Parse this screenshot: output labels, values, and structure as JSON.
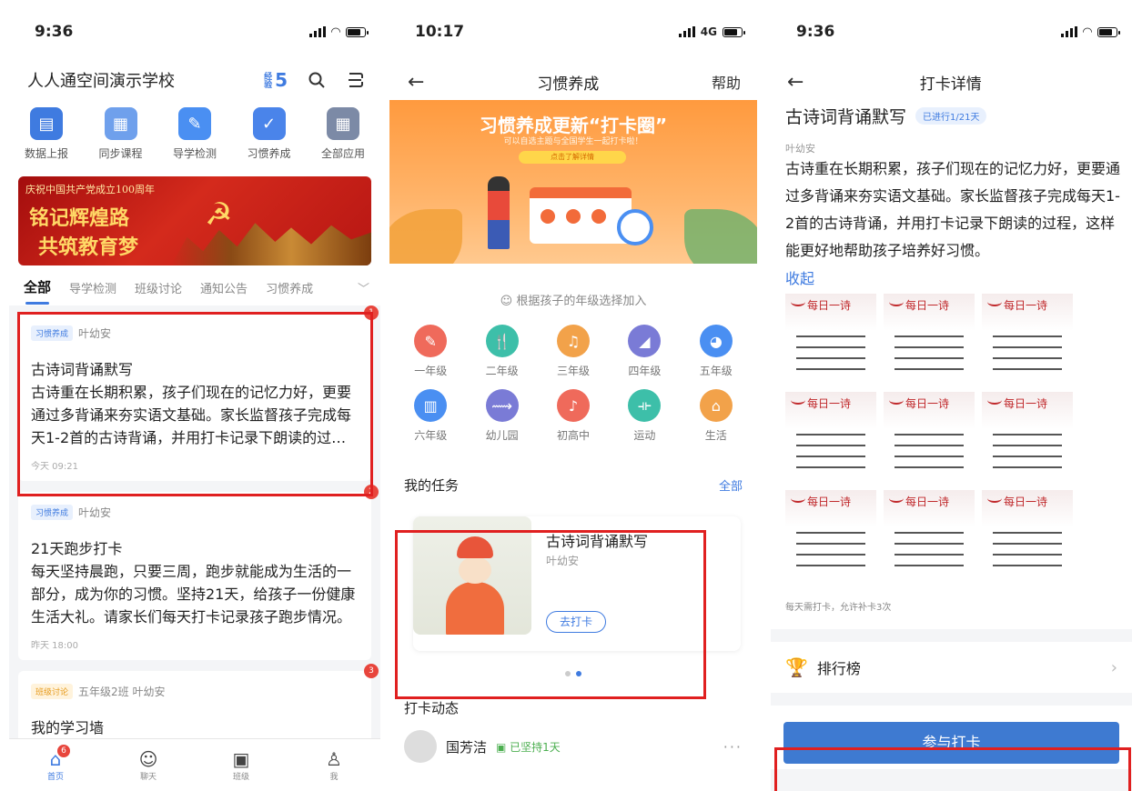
{
  "screen1": {
    "time": "9:36",
    "school": "人人通空间演示学校",
    "badge_label": "经验",
    "badge_count": "5",
    "apps": [
      {
        "label": "数据上报",
        "color": "#3f7be0"
      },
      {
        "label": "同步课程",
        "color": "#6fa0ec"
      },
      {
        "label": "导学检测",
        "color": "#4a8ff2"
      },
      {
        "label": "习惯养成",
        "color": "#4a84ea"
      },
      {
        "label": "全部应用",
        "color": "#7c8aa6"
      }
    ],
    "banner": {
      "subtitle": "庆祝中国共产党成立100周年",
      "line1": "铭记辉煌路",
      "line2": "共筑教育梦"
    },
    "tabs": [
      "全部",
      "导学检测",
      "班级讨论",
      "通知公告",
      "习惯养成"
    ],
    "cards": [
      {
        "tag": "习惯养成",
        "author": "叶幼安",
        "title": "古诗词背诵默写",
        "desc": "古诗重在长期积累，孩子们现在的记忆力好，更要通过多背诵来夯实语文基础。家长监督孩子完成每天1-2首的古诗背诵，并用打卡记录下朗读的过程。",
        "time": "今天 09:21",
        "dot": "1"
      },
      {
        "tag": "习惯养成",
        "author": "叶幼安",
        "title": "21天跑步打卡",
        "desc": "每天坚持晨跑，只要三周，跑步就能成为生活的一部分，成为你的习惯。坚持21天，给孩子一份健康生活大礼。请家长们每天打卡记录孩子跑步情况。",
        "time": "昨天 18:00",
        "dot": "2"
      },
      {
        "tag": "班级讨论",
        "author": "五年级2班 叶幼安",
        "title": "我的学习墙",
        "desc": "",
        "time": "",
        "dot": "3"
      }
    ],
    "tabbar": [
      {
        "label": "首页",
        "badge": "6"
      },
      {
        "label": "聊天"
      },
      {
        "label": "班级"
      },
      {
        "label": "我"
      }
    ]
  },
  "screen2": {
    "time": "10:17",
    "network": "4G",
    "title": "习惯养成",
    "help": "帮助",
    "hero": {
      "title": "习惯养成更新“打卡圈”",
      "subtitle": "可以自选主题与全国学生一起打卡啦！",
      "button": "点击了解详情"
    },
    "pick_hint": "根据孩子的年级选择加入",
    "grades": [
      {
        "label": "一年级",
        "color": "#ef6a5b",
        "icon": "✎"
      },
      {
        "label": "二年级",
        "color": "#3dbfa9",
        "icon": "🍴"
      },
      {
        "label": "三年级",
        "color": "#f2a24a",
        "icon": "♫"
      },
      {
        "label": "四年级",
        "color": "#7a7bd6",
        "icon": "◢"
      },
      {
        "label": "五年级",
        "color": "#4a8ff2",
        "icon": "◕"
      },
      {
        "label": "六年级",
        "color": "#4a8ff2",
        "icon": "▥"
      },
      {
        "label": "幼儿园",
        "color": "#7a7bd6",
        "icon": "⟿"
      },
      {
        "label": "初高中",
        "color": "#ef6a5b",
        "icon": "♪"
      },
      {
        "label": "运动",
        "color": "#3dbfa9",
        "icon": "⟛"
      },
      {
        "label": "生活",
        "color": "#f2a24a",
        "icon": "⌂"
      }
    ],
    "my_tasks": "我的任务",
    "all": "全部",
    "task": {
      "title": "古诗词背诵默写",
      "author": "叶幼安",
      "button": "去打卡"
    },
    "dynamics": "打卡动态",
    "feed_name": "国芳洁",
    "feed_keep": "已坚持1天"
  },
  "screen3": {
    "time": "9:36",
    "title": "打卡详情",
    "task_title": "古诗词背诵默写",
    "progress": "已进行1/21天",
    "author": "叶幼安",
    "desc": "古诗重在长期积累，孩子们现在的记忆力好，更要通过多背诵来夯实语文基础。家长监督孩子完成每天1-2首的古诗背诵，并用打卡记录下朗读的过程，这样能更好地帮助孩子培养好习惯。",
    "collapse": "收起",
    "poem_header": "每日一诗",
    "note": "每天需打卡，允许补卡3次",
    "rank": "排行榜",
    "join": "参与打卡"
  }
}
